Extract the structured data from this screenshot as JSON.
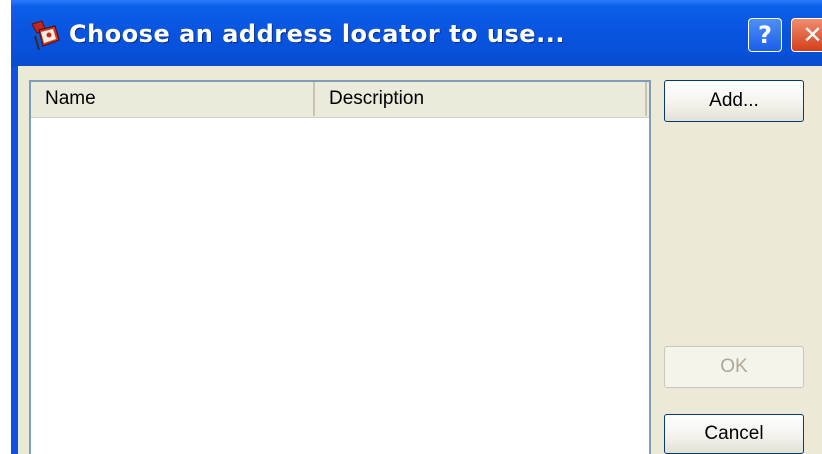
{
  "window": {
    "title": "Choose an address locator to use...",
    "help_glyph": "?",
    "close_glyph": "✕",
    "icon": "address-locator-icon"
  },
  "list": {
    "columns": [
      "Name",
      "Description"
    ],
    "rows": []
  },
  "buttons": {
    "add": "Add...",
    "ok": "OK",
    "cancel": "Cancel"
  },
  "colors": {
    "titlebar": "#0a55e0",
    "dialog_background": "#ece9d8",
    "disabled_text": "#aca899"
  }
}
